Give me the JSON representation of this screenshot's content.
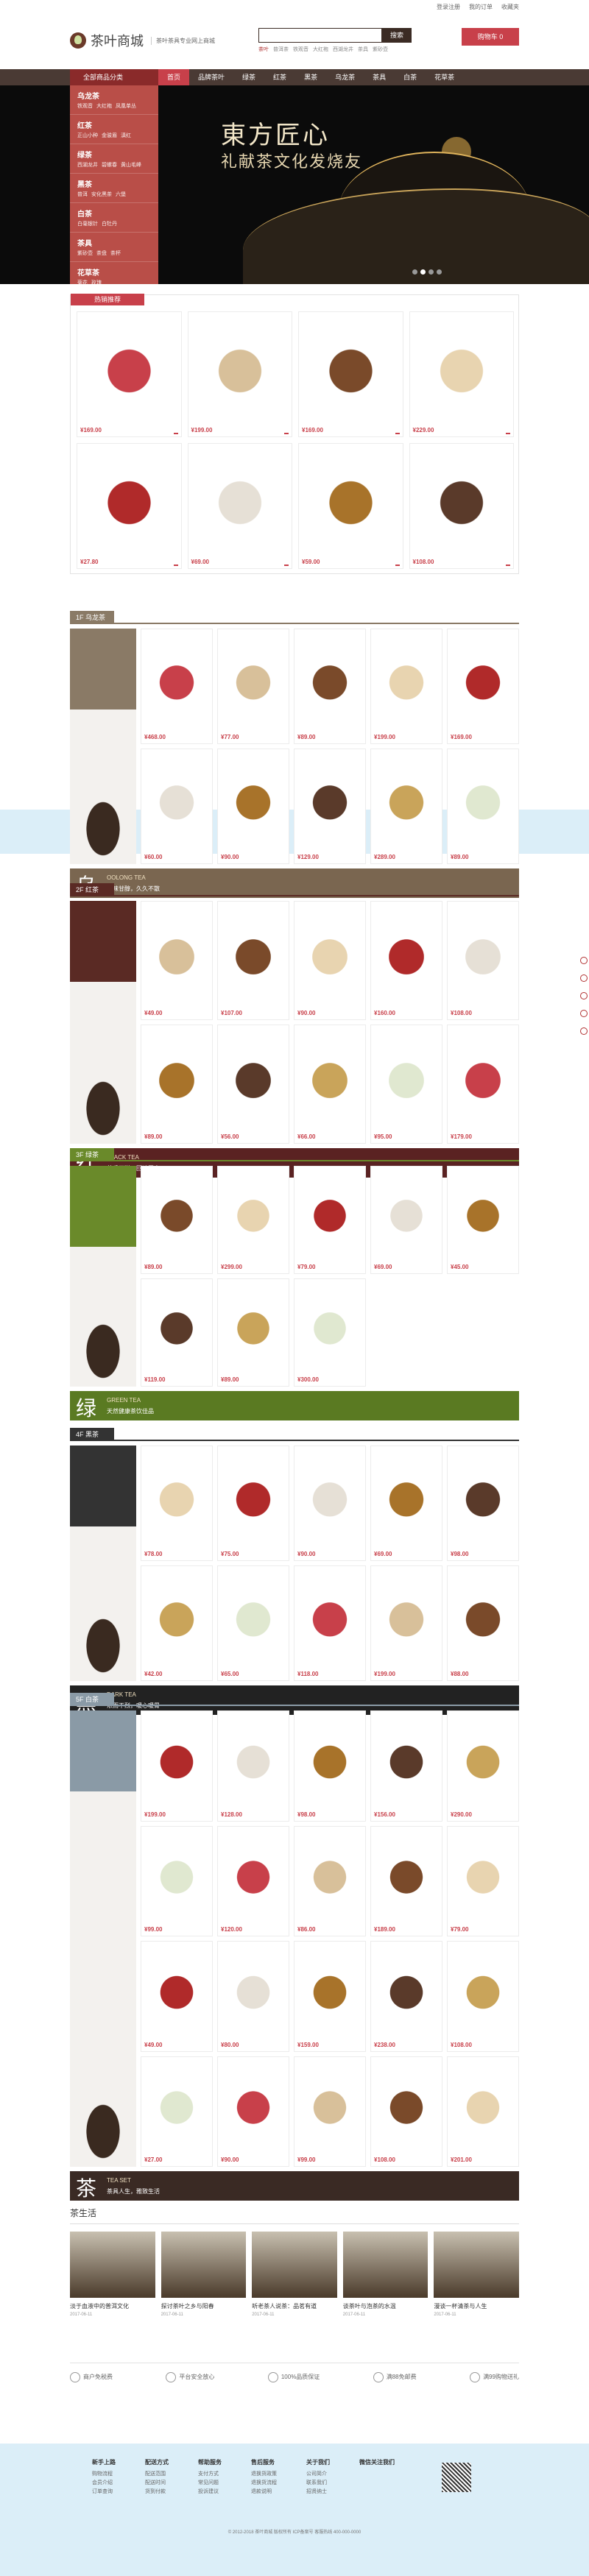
{
  "topbar": {
    "links": [
      "登录注册",
      "我的订单",
      "收藏夹"
    ]
  },
  "header": {
    "logo": "茶叶商城",
    "slogan": "茶叶茶具专业网上商城",
    "search_placeholder": "搜索",
    "search_btn": "搜索",
    "hotwords": [
      "茶叶",
      "普洱茶",
      "铁观音",
      "大红袍",
      "西湖龙井",
      "茶具",
      "紫砂壶"
    ],
    "cart": "购物车 0"
  },
  "nav": {
    "category": "全部商品分类",
    "items": [
      "首页",
      "品牌茶叶",
      "绿茶",
      "红茶",
      "黑茶",
      "乌龙茶",
      "茶具",
      "白茶",
      "花草茶"
    ]
  },
  "catmenu": [
    {
      "h": "乌龙茶",
      "s": [
        "铁观音",
        "大红袍",
        "凤凰单丛"
      ]
    },
    {
      "h": "红茶",
      "s": [
        "正山小种",
        "金骏眉",
        "滇红"
      ]
    },
    {
      "h": "绿茶",
      "s": [
        "西湖龙井",
        "碧螺春",
        "黄山毛峰"
      ]
    },
    {
      "h": "黑茶",
      "s": [
        "普洱",
        "安化黑茶",
        "六堡"
      ]
    },
    {
      "h": "白茶",
      "s": [
        "白毫银针",
        "白牡丹"
      ]
    },
    {
      "h": "茶具",
      "s": [
        "紫砂壶",
        "茶盘",
        "茶杯"
      ]
    },
    {
      "h": "花草茶",
      "s": [
        "菊花",
        "玫瑰"
      ]
    }
  ],
  "banner": {
    "title": "東方匠心",
    "sub": "礼献茶文化发烧友"
  },
  "rec": {
    "tag": "热销推荐",
    "prices": [
      "¥169.00",
      "¥199.00",
      "¥169.00",
      "¥229.00",
      "¥27.80",
      "¥69.00",
      "¥59.00",
      "¥108.00"
    ]
  },
  "floors": [
    {
      "name": "1F 乌龙茶",
      "color": "#8a7a66",
      "strip": "乌",
      "strip_en": "OOLONG TEA",
      "strip_cn": "回味甘醇，久久不散",
      "strip_color": "#7a6650",
      "prices": [
        "¥468.00",
        "¥77.00",
        "¥89.00",
        "¥199.00",
        "¥169.00",
        "¥60.00",
        "¥90.00",
        "¥129.00",
        "¥289.00",
        "¥89.00"
      ]
    },
    {
      "name": "2F 红茶",
      "color": "#5a2a24",
      "strip": "红",
      "strip_en": "BLACK TEA",
      "strip_cn": "茶香四溢，回味无穷",
      "strip_color": "#5a2222",
      "prices": [
        "¥49.00",
        "¥107.00",
        "¥90.00",
        "¥160.00",
        "¥108.00",
        "¥89.00",
        "¥56.00",
        "¥66.00",
        "¥95.00",
        "¥179.00"
      ]
    },
    {
      "name": "3F 绿茶",
      "color": "#6a8a2a",
      "strip": "绿",
      "strip_en": "GREEN TEA",
      "strip_cn": "天然健康茶饮佳品",
      "strip_color": "#5a7a22",
      "prices": [
        "¥89.00",
        "¥299.00",
        "¥79.00",
        "¥69.00",
        "¥45.00",
        "¥119.00",
        "¥89.00",
        "¥300.00"
      ]
    },
    {
      "name": "4F 黑茶",
      "color": "#333333",
      "strip": "黑",
      "strip_en": "DARK TEA",
      "strip_cn": "浓而不烈，暖心暖胃",
      "strip_color": "#222222",
      "prices": [
        "¥78.00",
        "¥75.00",
        "¥90.00",
        "¥69.00",
        "¥98.00",
        "¥42.00",
        "¥65.00",
        "¥118.00",
        "¥199.00",
        "¥88.00"
      ]
    },
    {
      "name": "5F 白茶",
      "color": "#8a9aa6",
      "strip": "茶",
      "strip_en": "TEA SET",
      "strip_cn": "茶具人生，雅致生活",
      "strip_color": "#3a2a24",
      "prices": [
        "¥199.00",
        "¥128.00",
        "¥98.00",
        "¥156.00",
        "¥290.00",
        "¥99.00",
        "¥120.00",
        "¥86.00",
        "¥189.00",
        "¥79.00",
        "¥49.00",
        "¥80.00",
        "¥159.00",
        "¥238.00",
        "¥108.00",
        "¥27.00",
        "¥90.00",
        "¥99.00",
        "¥108.00",
        "¥201.00"
      ]
    }
  ],
  "news": {
    "title": "茶生活",
    "items": [
      {
        "t": "淡于血液中的普洱文化",
        "d": "2017-06-11"
      },
      {
        "t": "探讨茶叶之乡与阳春",
        "d": "2017-06-11"
      },
      {
        "t": "听老茶人说茶：品茗有道",
        "d": "2017-06-11"
      },
      {
        "t": "谈茶叶与泡茶的水温",
        "d": "2017-06-11"
      },
      {
        "t": "漫谈一杯清茶与人生",
        "d": "2017-06-11"
      }
    ]
  },
  "service": [
    "商户免税费",
    "平台安全放心",
    "100%品质保证",
    "满88免邮费",
    "满99购物送礼"
  ],
  "footer": {
    "cols": [
      {
        "h": "新手上路",
        "l": [
          "购物流程",
          "会员介绍",
          "订单查询"
        ]
      },
      {
        "h": "配送方式",
        "l": [
          "配送范围",
          "配送时间",
          "货到付款"
        ]
      },
      {
        "h": "帮助服务",
        "l": [
          "支付方式",
          "常见问题",
          "投诉建议"
        ]
      },
      {
        "h": "售后服务",
        "l": [
          "退换货政策",
          "退换货流程",
          "退款说明"
        ]
      },
      {
        "h": "关于我们",
        "l": [
          "公司简介",
          "联系我们",
          "招贤纳士"
        ]
      },
      {
        "h": "微信关注我们",
        "l": []
      }
    ],
    "copy": "© 2012-2018 茶叶商城 版权所有 ICP备案号 客服热线 400-000-0000"
  }
}
